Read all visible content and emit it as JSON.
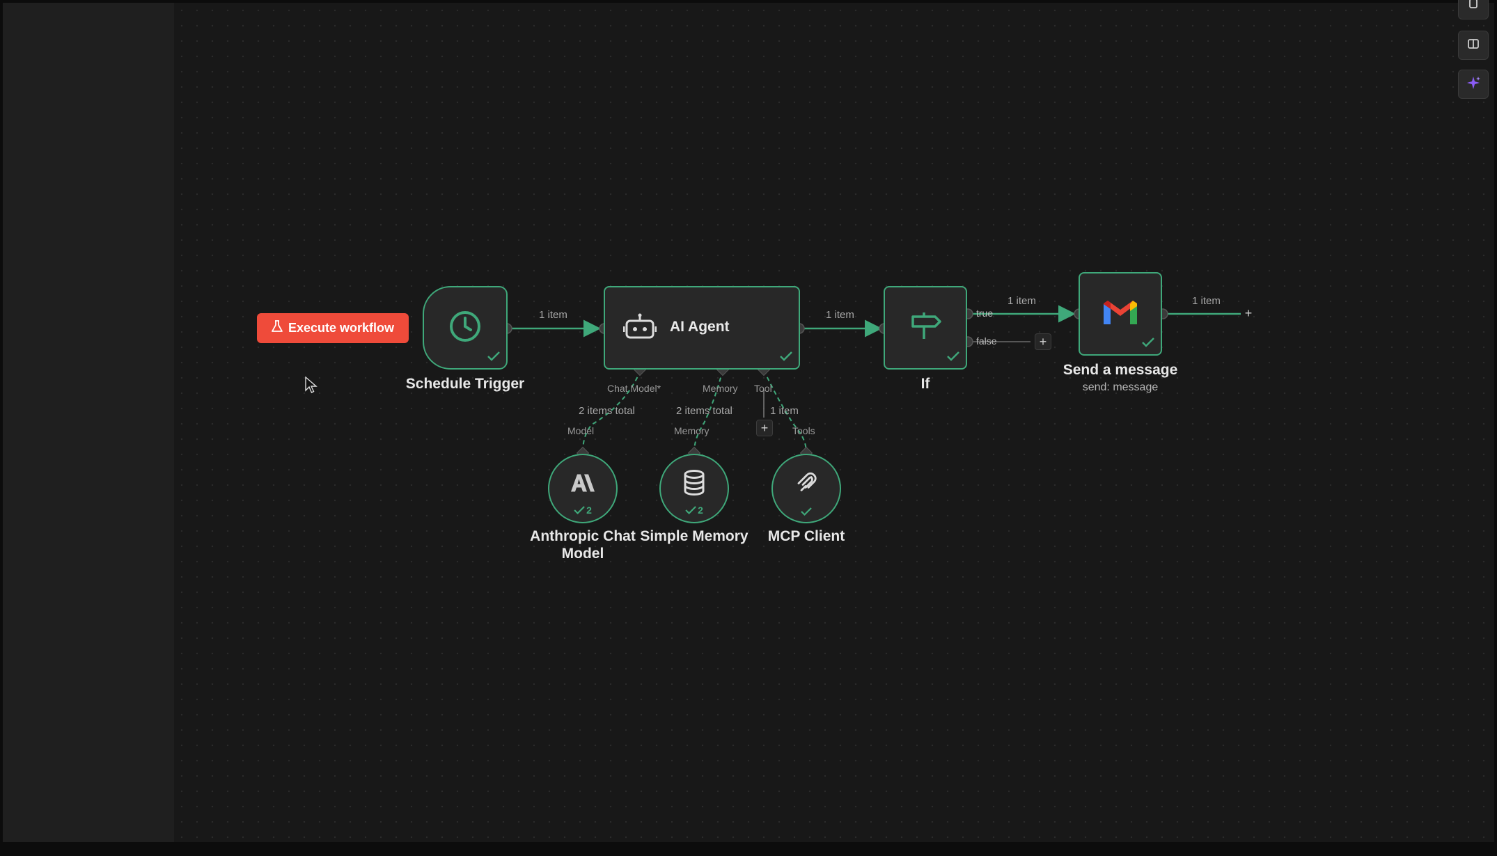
{
  "execute_button": {
    "label": "Execute workflow",
    "icon": "flask-icon",
    "color": "#ef4b3a"
  },
  "accent_color": "#3fa87a",
  "nodes": {
    "schedule_trigger": {
      "label": "Schedule Trigger",
      "icon": "clock-icon"
    },
    "ai_agent": {
      "label": "AI Agent",
      "icon": "robot-icon"
    },
    "if_node": {
      "label": "If",
      "icon": "signpost-icon"
    },
    "send_message": {
      "label": "Send a message",
      "sublabel": "send: message",
      "icon": "gmail-icon"
    },
    "anthropic_model": {
      "label": "Anthropic Chat Model",
      "icon": "anthropic-icon",
      "count": "2"
    },
    "simple_memory": {
      "label": "Simple Memory",
      "icon": "database-icon",
      "count": "2"
    },
    "mcp_client": {
      "label": "MCP Client",
      "icon": "mcp-icon"
    }
  },
  "edges": {
    "trigger_to_agent": "1 item",
    "agent_to_if": "1 item",
    "if_true": "1 item",
    "send_output": "1 item",
    "model_items": "2 items total",
    "memory_items": "2 items total",
    "tool_items": "1 item"
  },
  "handles": {
    "chat_model": "Chat Model*",
    "memory": "Memory",
    "tool": "Tool",
    "true_branch": "true",
    "false_branch": "false",
    "model_input": "Model",
    "memory_input": "Memory",
    "tools_input": "Tools"
  },
  "right_toolbar": [
    {
      "icon": "copy-icon"
    },
    {
      "icon": "panel-icon"
    },
    {
      "icon": "sparkle-icon",
      "color": "#8b5cf6"
    }
  ]
}
